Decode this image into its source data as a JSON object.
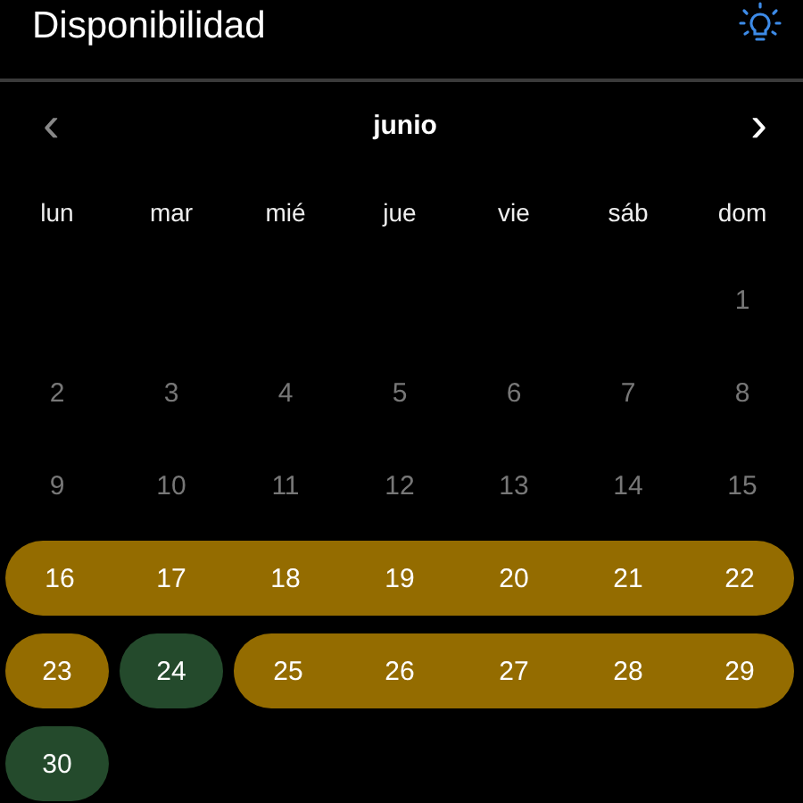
{
  "header": {
    "title": "Disponibilidad"
  },
  "month": {
    "prev": "‹",
    "label": "junio",
    "next": "›"
  },
  "weekdays": [
    "lun",
    "mar",
    "mié",
    "jue",
    "vie",
    "sáb",
    "dom"
  ],
  "weeks": [
    {
      "days": [
        {
          "day": "1",
          "disabled": true
        }
      ]
    },
    {
      "days": [
        {
          "day": "2",
          "disabled": true
        },
        {
          "day": "3",
          "disabled": true
        },
        {
          "day": "4",
          "disabled": true
        },
        {
          "day": "5",
          "disabled": true
        },
        {
          "day": "6",
          "disabled": true
        },
        {
          "day": "7",
          "disabled": true
        },
        {
          "day": "8",
          "disabled": true
        }
      ]
    },
    {
      "days": [
        {
          "day": "9",
          "disabled": true
        },
        {
          "day": "10",
          "disabled": true
        },
        {
          "day": "11",
          "disabled": true
        },
        {
          "day": "12",
          "disabled": true
        },
        {
          "day": "13",
          "disabled": true
        },
        {
          "day": "14",
          "disabled": true
        },
        {
          "day": "15",
          "disabled": true
        }
      ]
    },
    {
      "days": [
        {
          "day": "16",
          "disabled": false,
          "color": "#946c00"
        },
        {
          "day": "17",
          "disabled": false,
          "color": "#946c00"
        },
        {
          "day": "18",
          "disabled": false,
          "color": "#946c00"
        },
        {
          "day": "19",
          "disabled": false,
          "color": "#946c00"
        },
        {
          "day": "20",
          "disabled": false,
          "color": "#946c00"
        },
        {
          "day": "21",
          "disabled": false,
          "color": "#946c00"
        },
        {
          "day": "22",
          "disabled": false,
          "color": "#946c00"
        }
      ]
    },
    {
      "days": [
        {
          "day": "23",
          "disabled": false,
          "color": "#946c00"
        },
        {
          "day": "24",
          "disabled": false,
          "color": "#244a2c"
        },
        {
          "day": "25",
          "disabled": false,
          "color": "#946c00"
        },
        {
          "day": "26",
          "disabled": false,
          "color": "#946c00"
        },
        {
          "day": "27",
          "disabled": false,
          "color": "#946c00"
        },
        {
          "day": "28",
          "disabled": false,
          "color": "#946c00"
        },
        {
          "day": "29",
          "disabled": false,
          "color": "#946c00"
        }
      ]
    },
    {
      "days": [
        {
          "day": "30",
          "disabled": false,
          "color": "#244a2c"
        }
      ]
    }
  ]
}
